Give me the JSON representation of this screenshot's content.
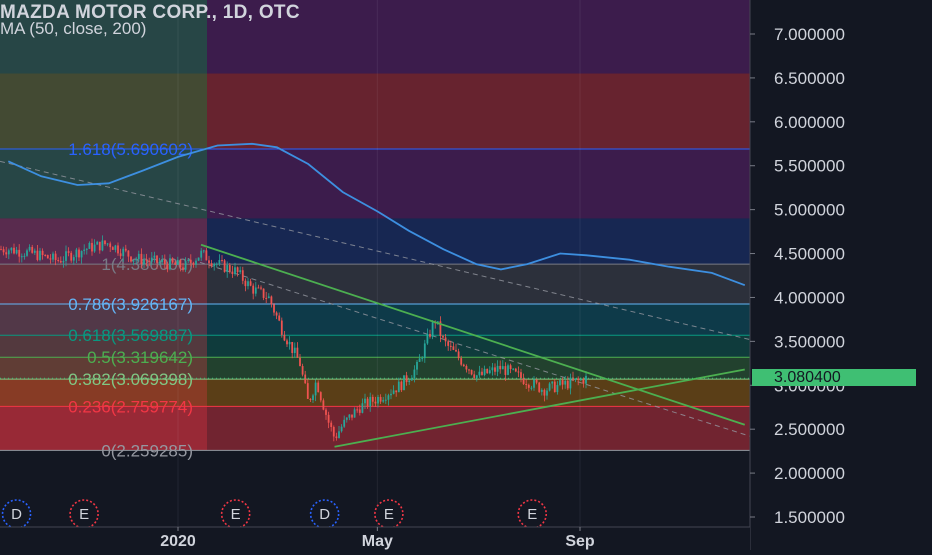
{
  "header": {
    "title": "MAZDA MOTOR CORP., 1D, OTC",
    "indicator": "MA (50, close, 200)"
  },
  "last_price": "3.080400",
  "colors": {
    "background": "#131722",
    "ma_line": "#3d8fe0",
    "candle_up": "#26a69a",
    "candle_down": "#ef5350",
    "trendline": "#4caf50",
    "last_price_tag": "#3fbf73"
  },
  "chart_data": {
    "type": "candlestick",
    "title": "MAZDA MOTOR CORP., 1D, OTC",
    "ylim": [
      1.3,
      7.3
    ],
    "y_ticks": [
      "1.500000",
      "2.000000",
      "2.500000",
      "3.000000",
      "3.500000",
      "4.000000",
      "4.500000",
      "5.000000",
      "5.500000",
      "6.000000",
      "6.500000",
      "7.000000"
    ],
    "x_ticks": [
      {
        "label": "2020",
        "date": "2020-01-01"
      },
      {
        "label": "May",
        "date": "2020-05-01"
      },
      {
        "label": "Sep",
        "date": "2020-09-01"
      }
    ],
    "grid": true,
    "fib_levels": [
      {
        "label": "0(2.259285)",
        "value": 2.259285
      },
      {
        "label": "0.236(2.759774)",
        "value": 2.759774
      },
      {
        "label": "0.382(3.069398)",
        "value": 3.069398
      },
      {
        "label": "0.5(3.319642)",
        "value": 3.319642
      },
      {
        "label": "0.618(3.569887)",
        "value": 3.569887
      },
      {
        "label": "0.786(3.926167)",
        "value": 3.926167
      },
      {
        "label": "1(4.380000)",
        "value": 4.38
      },
      {
        "label": "1.618(5.690602)",
        "value": 5.690602
      }
    ],
    "ma_series": {
      "name": "MA (50, close, 200)",
      "points": [
        [
          "2019-09-20",
          5.55
        ],
        [
          "2019-10-10",
          5.38
        ],
        [
          "2019-11-01",
          5.28
        ],
        [
          "2019-11-20",
          5.3
        ],
        [
          "2019-12-10",
          5.44
        ],
        [
          "2020-01-01",
          5.6
        ],
        [
          "2020-01-25",
          5.73
        ],
        [
          "2020-02-15",
          5.75
        ],
        [
          "2020-03-01",
          5.71
        ],
        [
          "2020-03-20",
          5.52
        ],
        [
          "2020-04-10",
          5.2
        ],
        [
          "2020-05-01",
          4.98
        ],
        [
          "2020-05-20",
          4.76
        ],
        [
          "2020-06-10",
          4.55
        ],
        [
          "2020-06-30",
          4.38
        ],
        [
          "2020-07-15",
          4.32
        ],
        [
          "2020-07-31",
          4.38
        ],
        [
          "2020-08-20",
          4.5
        ],
        [
          "2020-09-05",
          4.48
        ],
        [
          "2020-10-01",
          4.43
        ],
        [
          "2020-10-25",
          4.35
        ],
        [
          "2020-11-20",
          4.28
        ],
        [
          "2020-12-10",
          4.14
        ]
      ]
    },
    "price_series": {
      "name": "Close",
      "points": [
        [
          "2019-09-20",
          4.55
        ],
        [
          "2019-10-05",
          4.5
        ],
        [
          "2019-10-20",
          4.42
        ],
        [
          "2019-11-05",
          4.55
        ],
        [
          "2019-11-20",
          4.62
        ],
        [
          "2019-12-05",
          4.45
        ],
        [
          "2019-12-20",
          4.4
        ],
        [
          "2020-01-05",
          4.35
        ],
        [
          "2020-01-15",
          4.5
        ],
        [
          "2020-01-25",
          4.38
        ],
        [
          "2020-02-05",
          4.3
        ],
        [
          "2020-02-15",
          4.1
        ],
        [
          "2020-02-25",
          4.0
        ],
        [
          "2020-03-05",
          3.6
        ],
        [
          "2020-03-15",
          3.25
        ],
        [
          "2020-03-20",
          2.8
        ],
        [
          "2020-03-25",
          3.05
        ],
        [
          "2020-04-01",
          2.6
        ],
        [
          "2020-04-05",
          2.4
        ],
        [
          "2020-04-10",
          2.55
        ],
        [
          "2020-04-20",
          2.75
        ],
        [
          "2020-05-01",
          2.85
        ],
        [
          "2020-05-15",
          3.0
        ],
        [
          "2020-05-25",
          3.2
        ],
        [
          "2020-06-05",
          3.75
        ],
        [
          "2020-06-10",
          3.5
        ],
        [
          "2020-06-20",
          3.3
        ],
        [
          "2020-07-01",
          3.1
        ],
        [
          "2020-07-15",
          3.2
        ],
        [
          "2020-07-31",
          3.05
        ],
        [
          "2020-08-10",
          2.95
        ],
        [
          "2020-08-20",
          3.0
        ],
        [
          "2020-08-31",
          3.05
        ],
        [
          "2020-09-05",
          3.08
        ]
      ]
    },
    "trendlines": [
      {
        "from": [
          "2020-01-15",
          4.6
        ],
        "to": [
          "2020-12-10",
          2.55
        ]
      },
      {
        "from": [
          "2020-04-05",
          2.3
        ],
        "to": [
          "2020-12-10",
          3.18
        ]
      }
    ],
    "event_markers": [
      {
        "label": "D",
        "date": "2019-09-25"
      },
      {
        "label": "E",
        "date": "2019-11-05"
      },
      {
        "label": "E",
        "date": "2020-02-05"
      },
      {
        "label": "D",
        "date": "2020-03-30"
      },
      {
        "label": "E",
        "date": "2020-05-08"
      },
      {
        "label": "E",
        "date": "2020-08-03"
      }
    ]
  }
}
